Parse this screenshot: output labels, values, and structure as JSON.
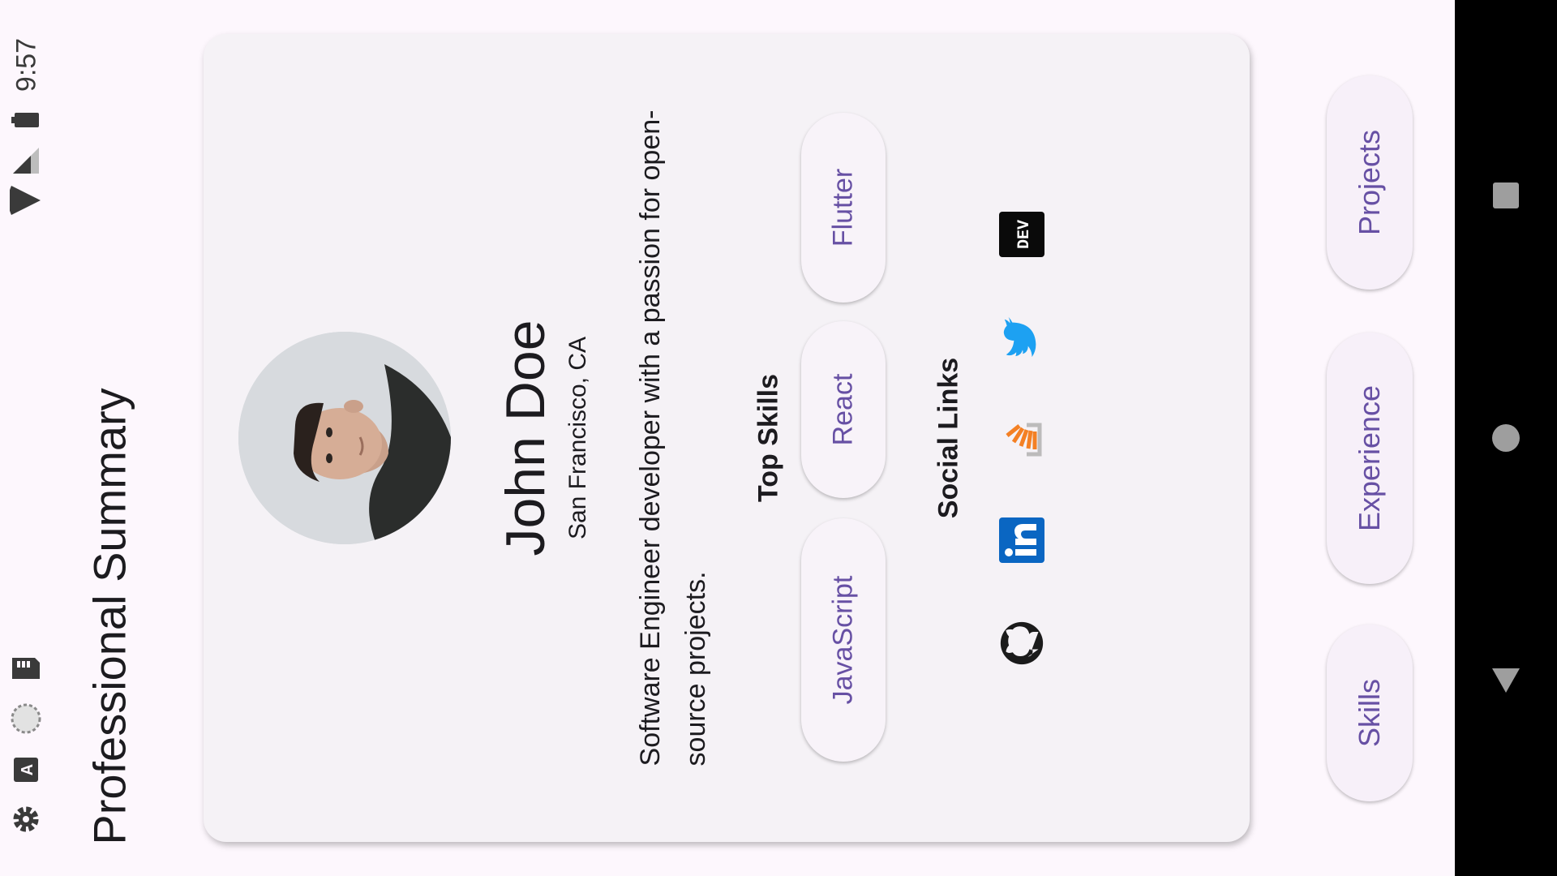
{
  "status_bar": {
    "time": "9:57",
    "icons": [
      "settings-icon",
      "a11y-text-icon",
      "sync-icon",
      "sd-card-icon",
      "wifi-icon",
      "signal-icon",
      "battery-icon"
    ]
  },
  "app_bar": {
    "title": "Professional Summary"
  },
  "profile": {
    "name": "John Doe",
    "location": "San Francisco, CA",
    "bio_line1": "Software Engineer developer with a passion for open-",
    "bio_line2": "source projects."
  },
  "skills": {
    "title": "Top Skills",
    "items": [
      "JavaScript",
      "React",
      "Flutter"
    ]
  },
  "social": {
    "title": "Social Links",
    "links": [
      "github-icon",
      "linkedin-icon",
      "stackoverflow-icon",
      "twitter-icon",
      "dev-icon"
    ]
  },
  "bottom_buttons": [
    "Skills",
    "Experience",
    "Projects"
  ],
  "nav_bar": {
    "buttons": [
      "back-icon",
      "home-icon",
      "recents-icon"
    ]
  },
  "colors": {
    "accent": "#6750a4",
    "background": "#fdf7fd",
    "card": "#f5f2f6",
    "linkedin": "#0a66c2",
    "stackoverflow": "#f48024",
    "twitter": "#1da1f2"
  }
}
